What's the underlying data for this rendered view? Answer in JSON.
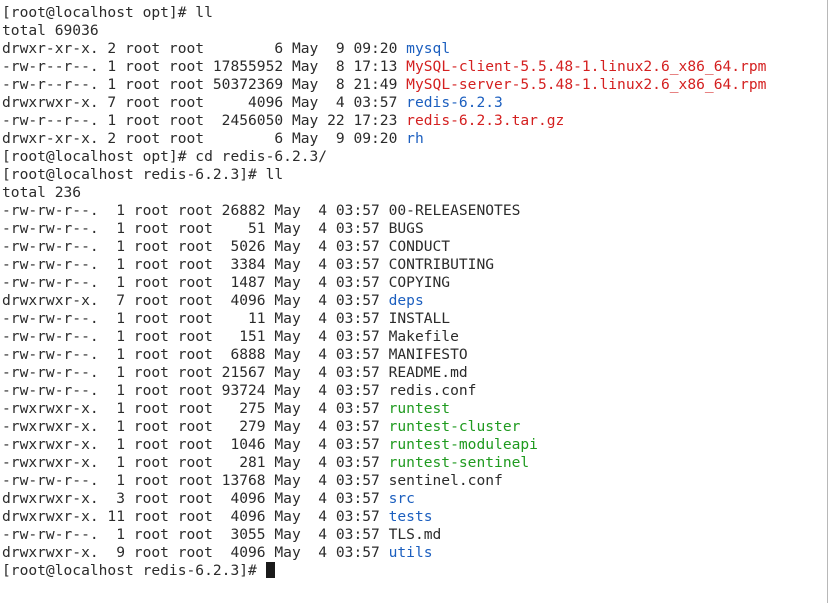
{
  "colors": {
    "background": "#ffffff",
    "text": "#2b2b2b",
    "directory": "#1c5fbf",
    "archive": "#d42020",
    "executable": "#1f9a1f"
  },
  "lines": [
    {
      "kind": "text",
      "text": "[root@localhost opt]# ll"
    },
    {
      "kind": "text",
      "text": "total 69036"
    },
    {
      "kind": "file",
      "prefix": "drwxr-xr-x. 2 root root        6 May  9 09:20 ",
      "name": "mysql",
      "type": "dir"
    },
    {
      "kind": "file",
      "prefix": "-rw-r--r--. 1 root root 17855952 May  8 17:13 ",
      "name": "MySQL-client-5.5.48-1.linux2.6_x86_64.rpm",
      "type": "rpm"
    },
    {
      "kind": "file",
      "prefix": "-rw-r--r--. 1 root root 50372369 May  8 21:49 ",
      "name": "MySQL-server-5.5.48-1.linux2.6_x86_64.rpm",
      "type": "rpm"
    },
    {
      "kind": "file",
      "prefix": "drwxrwxr-x. 7 root root     4096 May  4 03:57 ",
      "name": "redis-6.2.3",
      "type": "dir"
    },
    {
      "kind": "file",
      "prefix": "-rw-r--r--. 1 root root  2456050 May 22 17:23 ",
      "name": "redis-6.2.3.tar.gz",
      "type": "archive"
    },
    {
      "kind": "file",
      "prefix": "drwxr-xr-x. 2 root root        6 May  9 09:20 ",
      "name": "rh",
      "type": "dir"
    },
    {
      "kind": "text",
      "text": "[root@localhost opt]# cd redis-6.2.3/"
    },
    {
      "kind": "text",
      "text": "[root@localhost redis-6.2.3]# ll"
    },
    {
      "kind": "text",
      "text": "total 236"
    },
    {
      "kind": "file",
      "prefix": "-rw-rw-r--.  1 root root 26882 May  4 03:57 ",
      "name": "00-RELEASENOTES",
      "type": "plain"
    },
    {
      "kind": "file",
      "prefix": "-rw-rw-r--.  1 root root    51 May  4 03:57 ",
      "name": "BUGS",
      "type": "plain"
    },
    {
      "kind": "file",
      "prefix": "-rw-rw-r--.  1 root root  5026 May  4 03:57 ",
      "name": "CONDUCT",
      "type": "plain"
    },
    {
      "kind": "file",
      "prefix": "-rw-rw-r--.  1 root root  3384 May  4 03:57 ",
      "name": "CONTRIBUTING",
      "type": "plain"
    },
    {
      "kind": "file",
      "prefix": "-rw-rw-r--.  1 root root  1487 May  4 03:57 ",
      "name": "COPYING",
      "type": "plain"
    },
    {
      "kind": "file",
      "prefix": "drwxrwxr-x.  7 root root  4096 May  4 03:57 ",
      "name": "deps",
      "type": "dir"
    },
    {
      "kind": "file",
      "prefix": "-rw-rw-r--.  1 root root    11 May  4 03:57 ",
      "name": "INSTALL",
      "type": "plain"
    },
    {
      "kind": "file",
      "prefix": "-rw-rw-r--.  1 root root   151 May  4 03:57 ",
      "name": "Makefile",
      "type": "plain"
    },
    {
      "kind": "file",
      "prefix": "-rw-rw-r--.  1 root root  6888 May  4 03:57 ",
      "name": "MANIFESTO",
      "type": "plain"
    },
    {
      "kind": "file",
      "prefix": "-rw-rw-r--.  1 root root 21567 May  4 03:57 ",
      "name": "README.md",
      "type": "plain"
    },
    {
      "kind": "file",
      "prefix": "-rw-rw-r--.  1 root root 93724 May  4 03:57 ",
      "name": "redis.conf",
      "type": "plain"
    },
    {
      "kind": "file",
      "prefix": "-rwxrwxr-x.  1 root root   275 May  4 03:57 ",
      "name": "runtest",
      "type": "exec"
    },
    {
      "kind": "file",
      "prefix": "-rwxrwxr-x.  1 root root   279 May  4 03:57 ",
      "name": "runtest-cluster",
      "type": "exec"
    },
    {
      "kind": "file",
      "prefix": "-rwxrwxr-x.  1 root root  1046 May  4 03:57 ",
      "name": "runtest-moduleapi",
      "type": "exec"
    },
    {
      "kind": "file",
      "prefix": "-rwxrwxr-x.  1 root root   281 May  4 03:57 ",
      "name": "runtest-sentinel",
      "type": "exec"
    },
    {
      "kind": "file",
      "prefix": "-rw-rw-r--.  1 root root 13768 May  4 03:57 ",
      "name": "sentinel.conf",
      "type": "plain"
    },
    {
      "kind": "file",
      "prefix": "drwxrwxr-x.  3 root root  4096 May  4 03:57 ",
      "name": "src",
      "type": "dir"
    },
    {
      "kind": "file",
      "prefix": "drwxrwxr-x. 11 root root  4096 May  4 03:57 ",
      "name": "tests",
      "type": "dir"
    },
    {
      "kind": "file",
      "prefix": "-rw-rw-r--.  1 root root  3055 May  4 03:57 ",
      "name": "TLS.md",
      "type": "plain"
    },
    {
      "kind": "file",
      "prefix": "drwxrwxr-x.  9 root root  4096 May  4 03:57 ",
      "name": "utils",
      "type": "dir"
    }
  ],
  "prompt": "[root@localhost redis-6.2.3]# "
}
